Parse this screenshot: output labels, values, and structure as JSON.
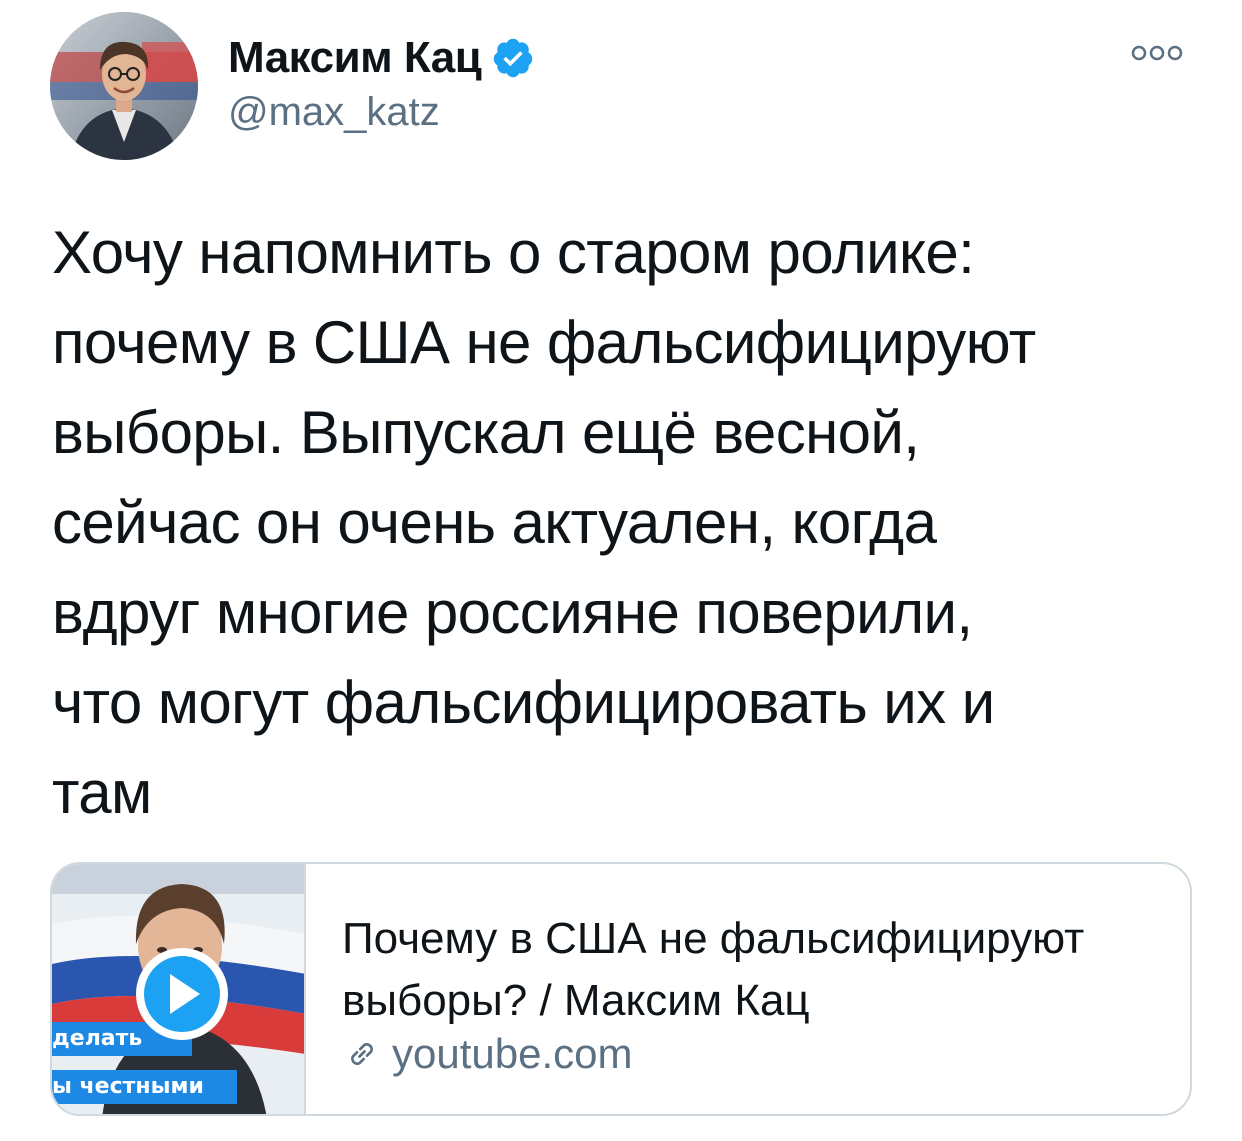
{
  "author": {
    "name": "Максим Кац",
    "handle": "@max_katz",
    "verified": true,
    "avatar_icon": "profile-photo"
  },
  "more_icon": "more-options-icon",
  "tweet": {
    "text": "Хочу напомнить о старом ролике:\nпочему в США не фальсифицируют\nвыборы. Выпускал ещё весной,\nсейчас он очень актуален, когда\nвдруг многие россияне поверили,\nчто могут фальсифицировать их и\nтам"
  },
  "card": {
    "thumbnail_caption_1": "делать",
    "thumbnail_caption_2": "ы честными",
    "title": "Почему в США не фальсифицируют выборы? / Максим Кац",
    "domain": "youtube.com",
    "play_icon": "play-icon",
    "link_icon": "link-icon"
  },
  "colors": {
    "verified": "#1da1f2",
    "secondary_text": "#5b7083",
    "border": "#cfd9de",
    "play": "#1da1f2"
  }
}
